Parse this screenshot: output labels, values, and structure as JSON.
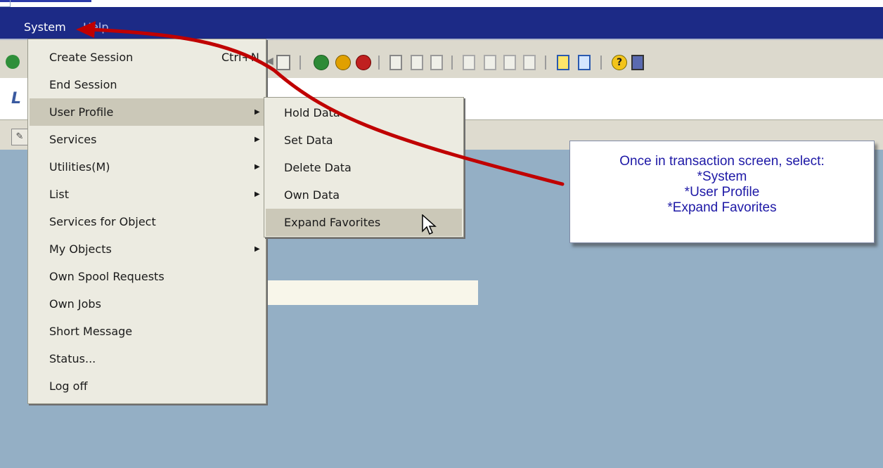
{
  "menubar": {
    "items": [
      "System",
      "Help"
    ]
  },
  "system_menu": {
    "items": [
      {
        "label": "Create Session",
        "shortcut": "Ctrl+N",
        "has_submenu": false,
        "selected": false
      },
      {
        "label": "End Session",
        "shortcut": "",
        "has_submenu": false,
        "selected": false
      },
      {
        "label": "User Profile",
        "shortcut": "",
        "has_submenu": true,
        "selected": true
      },
      {
        "label": "Services",
        "shortcut": "",
        "has_submenu": true,
        "selected": false
      },
      {
        "label": "Utilities(M)",
        "shortcut": "",
        "has_submenu": true,
        "selected": false
      },
      {
        "label": "List",
        "shortcut": "",
        "has_submenu": true,
        "selected": false
      },
      {
        "label": "Services for Object",
        "shortcut": "",
        "has_submenu": false,
        "selected": false
      },
      {
        "label": "My Objects",
        "shortcut": "",
        "has_submenu": true,
        "selected": false
      },
      {
        "label": "Own Spool Requests",
        "shortcut": "",
        "has_submenu": false,
        "selected": false
      },
      {
        "label": "Own Jobs",
        "shortcut": "",
        "has_submenu": false,
        "selected": false
      },
      {
        "label": "Short Message",
        "shortcut": "",
        "has_submenu": false,
        "selected": false
      },
      {
        "label": "Status...",
        "shortcut": "",
        "has_submenu": false,
        "selected": false
      },
      {
        "label": "Log off",
        "shortcut": "",
        "has_submenu": false,
        "selected": false
      }
    ]
  },
  "user_profile_submenu": {
    "items": [
      {
        "label": "Hold Data",
        "selected": false
      },
      {
        "label": "Set Data",
        "selected": false
      },
      {
        "label": "Delete Data",
        "selected": false
      },
      {
        "label": "Own Data",
        "selected": false
      },
      {
        "label": "Expand Favorites",
        "selected": true
      }
    ]
  },
  "title": {
    "partial_text": "L"
  },
  "callout": {
    "lines": [
      "Once in transaction screen, select:",
      "*System",
      "*User Profile",
      "*Expand Favorites"
    ]
  },
  "colors": {
    "menubar": "#1c2a86",
    "content_bg": "#94afc5",
    "arrow": "#c00000",
    "callout_text": "#1d18a6"
  },
  "toolbar_icons": [
    "enter-icon",
    "save-icon",
    "back-icon",
    "exit-icon",
    "cancel-icon",
    "print-icon",
    "find-icon",
    "find-next-icon",
    "first-page-icon",
    "previous-page-icon",
    "next-page-icon",
    "last-page-icon",
    "create-session-icon",
    "shortcut-icon",
    "help-icon",
    "layout-icon"
  ]
}
